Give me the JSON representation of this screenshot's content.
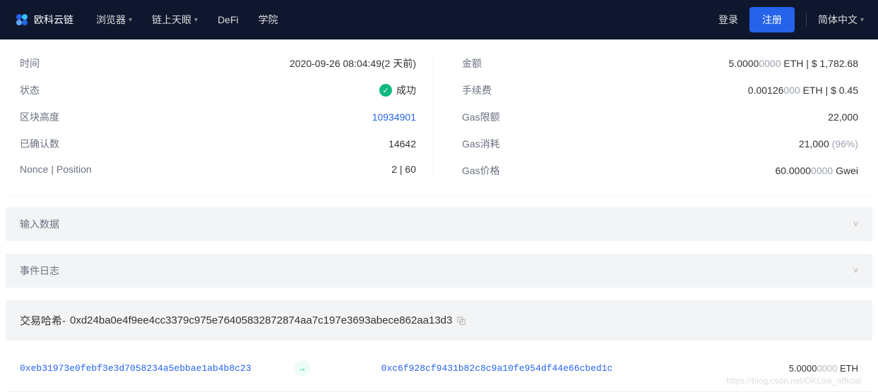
{
  "navbar": {
    "brand": "欧科云链",
    "items": [
      "浏览器",
      "链上天眼",
      "DeFi",
      "学院"
    ],
    "login": "登录",
    "register": "注册",
    "language": "简体中文"
  },
  "details": {
    "left": {
      "time": {
        "label": "时间",
        "value": "2020-09-26 08:04:49(2 天前)"
      },
      "status": {
        "label": "状态",
        "value": "成功"
      },
      "block_height": {
        "label": "区块高度",
        "value": "10934901"
      },
      "confirmations": {
        "label": "已确认数",
        "value": "14642"
      },
      "nonce_position": {
        "label": "Nonce | Position",
        "value": "2 | 60"
      }
    },
    "right": {
      "amount": {
        "label": "金额",
        "sig": "5.0000",
        "zeros": "0000",
        "unit": " ETH",
        "fiat_prefix": " | $ ",
        "fiat": "1,782.68"
      },
      "fee": {
        "label": "手续费",
        "sig": "0.00126",
        "zeros": "000",
        "unit": " ETH",
        "fiat_prefix": " | $ ",
        "fiat": "0.45"
      },
      "gas_limit": {
        "label": "Gas限额",
        "value": "22,000"
      },
      "gas_used": {
        "label": "Gas消耗",
        "value": "21,000 ",
        "pct": "(96%)"
      },
      "gas_price": {
        "label": "Gas价格",
        "sig": "60.0000",
        "zeros": "0000",
        "unit": " Gwei"
      }
    }
  },
  "accordions": {
    "input_data": "输入数据",
    "event_logs": "事件日志"
  },
  "tx": {
    "hash_label": "交易哈希-",
    "hash": "0xd24ba0e4f9ee4cc3379c975e76405832872874aa7c197e3693abece862aa13d3",
    "from": "0xeb31973e0febf3e3d7058234a5ebbae1ab4b8c23",
    "to": "0xc6f928cf9431b82c8c9a10fe954df44e66cbed1c",
    "amount_sig": "5.0000",
    "amount_zeros": "0000",
    "amount_unit": " ETH"
  },
  "watermark": "https://blog.csdn.net/OKLink_official"
}
